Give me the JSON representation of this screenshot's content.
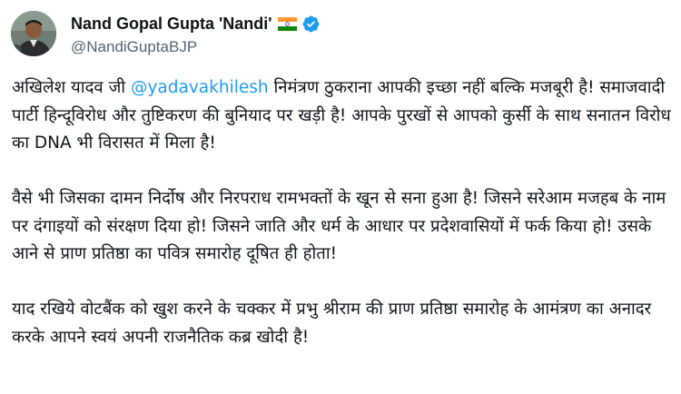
{
  "author": {
    "display_name": "Nand Gopal Gupta 'Nandi'",
    "handle": "@NandiGuptaBJP",
    "flag_icon": "india-flag-icon",
    "verified_icon": "verified-badge-icon"
  },
  "colors": {
    "link": "#1d9bf0",
    "verified": "#1d9bf0",
    "text": "#0f1419",
    "secondary": "#536471"
  },
  "tweet": {
    "p1_before": "अखिलेश यादव जी ",
    "p1_mention": "@yadavakhilesh",
    "p1_after": " निमंत्रण ठुकराना आपकी इच्छा नहीं बल्कि मजबूरी है! समाजवादी पार्टी हिन्दूविरोध और तुष्टिकरण की बुनियाद पर खड़ी है! आपके पुरखों से आपको कुर्सी के साथ सनातन विरोध का DNA भी विरासत में मिला है!",
    "p2": "वैसे भी जिसका दामन निर्दोष और निरपराध रामभक्तों के खून से सना हुआ है! जिसने सरेआम मजहब के नाम पर दंगाइयों को संरक्षण दिया हो! जिसने जाति और धर्म के आधार पर प्रदेशवासियों में फर्क किया हो! उसके आने से प्राण प्रतिष्ठा का पवित्र समारोह दूषित ही होता!",
    "p3": "याद रखिये वोटबैंक को खुश करने के चक्कर में प्रभु श्रीराम की प्राण प्रतिष्ठा समारोह के आमंत्रण का अनादर करके आपने स्वयं अपनी राजनैतिक कब्र खोदी है!"
  }
}
